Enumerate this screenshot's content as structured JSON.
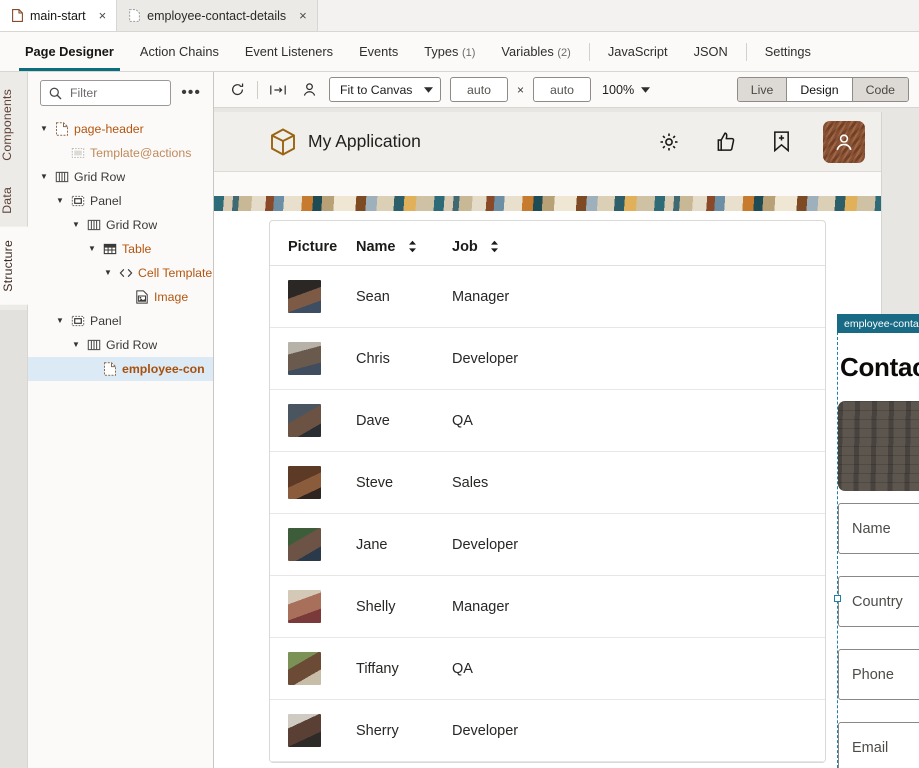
{
  "file_tabs": [
    {
      "label": "main-start",
      "icon": "document-icon",
      "active": true,
      "close": "×"
    },
    {
      "label": "employee-contact-details",
      "icon": "document-dashed-icon",
      "active": false,
      "close": "×"
    }
  ],
  "editor_tabs": [
    {
      "label": "Page Designer",
      "count": "",
      "active": true
    },
    {
      "label": "Action Chains",
      "count": "",
      "active": false
    },
    {
      "label": "Event Listeners",
      "count": "",
      "active": false
    },
    {
      "label": "Events",
      "count": "",
      "active": false
    },
    {
      "label": "Types",
      "count": "(1)",
      "active": false
    },
    {
      "label": "Variables",
      "count": "(2)",
      "active": false
    },
    {
      "label": "JavaScript",
      "count": "",
      "active": false
    },
    {
      "label": "JSON",
      "count": "",
      "active": false
    },
    {
      "label": "Settings",
      "count": "",
      "active": false
    }
  ],
  "rail": {
    "items": [
      {
        "label": "Components",
        "active": false
      },
      {
        "label": "Data",
        "active": false
      },
      {
        "label": "Structure",
        "active": true
      }
    ]
  },
  "structure": {
    "filter_placeholder": "Filter",
    "overflow_label": "•••",
    "tree": [
      {
        "label": "page-header",
        "depth": 0,
        "caret": "▼",
        "icon": "page-icon",
        "style": "orange",
        "selected": false
      },
      {
        "label": "Template@actions",
        "depth": 1,
        "caret": "",
        "icon": "template-icon",
        "style": "faded",
        "selected": false
      },
      {
        "label": "Grid Row",
        "depth": 0,
        "caret": "▼",
        "icon": "gridrow-icon",
        "style": "grey",
        "selected": false
      },
      {
        "label": "Panel",
        "depth": 1,
        "caret": "▼",
        "icon": "panel-icon",
        "style": "grey",
        "selected": false
      },
      {
        "label": "Grid Row",
        "depth": 2,
        "caret": "▼",
        "icon": "gridrow-icon",
        "style": "grey",
        "selected": false
      },
      {
        "label": "Table",
        "depth": 3,
        "caret": "▼",
        "icon": "table-icon",
        "style": "orange",
        "selected": false
      },
      {
        "label": "Cell Template",
        "depth": 4,
        "caret": "▼",
        "icon": "code-icon",
        "style": "orange",
        "selected": false
      },
      {
        "label": "Image",
        "depth": 5,
        "caret": "",
        "icon": "image-icon",
        "style": "orange",
        "selected": false
      },
      {
        "label": "Panel",
        "depth": 1,
        "caret": "▼",
        "icon": "panel-icon",
        "style": "grey",
        "selected": false
      },
      {
        "label": "Grid Row",
        "depth": 2,
        "caret": "▼",
        "icon": "gridrow-icon",
        "style": "grey",
        "selected": false
      },
      {
        "label": "employee-con",
        "depth": 3,
        "caret": "",
        "icon": "page-icon",
        "style": "selected",
        "selected": true
      }
    ]
  },
  "canvas_toolbar": {
    "refresh_icon": "refresh-icon",
    "resize_icon": "fit-width-icon",
    "user_icon": "user-icon",
    "fit_label": "Fit to Canvas",
    "width_value": "auto",
    "multiply": "×",
    "height_value": "auto",
    "zoom_value": "100%",
    "modes": [
      {
        "label": "Live",
        "active": false
      },
      {
        "label": "Design",
        "active": true
      },
      {
        "label": "Code",
        "active": false
      }
    ]
  },
  "app": {
    "logo_icon": "cube-logo-icon",
    "title": "My Application",
    "header_icons": [
      {
        "name": "gear-icon"
      },
      {
        "name": "thumbs-up-icon"
      },
      {
        "name": "bookmark-add-icon"
      }
    ],
    "avatar_icon": "user-avatar-icon"
  },
  "table": {
    "columns": [
      {
        "label": "Picture",
        "sortable": false
      },
      {
        "label": "Name",
        "sortable": true
      },
      {
        "label": "Job",
        "sortable": true
      }
    ],
    "rows": [
      {
        "picture": "employee-photo",
        "name": "Sean",
        "job": "Manager"
      },
      {
        "picture": "employee-photo",
        "name": "Chris",
        "job": "Developer"
      },
      {
        "picture": "employee-photo",
        "name": "Dave",
        "job": "QA"
      },
      {
        "picture": "employee-photo",
        "name": "Steve",
        "job": "Sales"
      },
      {
        "picture": "employee-photo",
        "name": "Jane",
        "job": "Developer"
      },
      {
        "picture": "employee-photo",
        "name": "Shelly",
        "job": "Manager"
      },
      {
        "picture": "employee-photo",
        "name": "Tiffany",
        "job": "QA"
      },
      {
        "picture": "employee-photo",
        "name": "Sherry",
        "job": "Developer"
      }
    ]
  },
  "fragment": {
    "tag_label": "employee-contact-details",
    "edit_icon": "pencil-icon",
    "heading": "Contact Info",
    "photo_placeholder": "photo-placeholder",
    "fields": [
      {
        "label": "Name"
      },
      {
        "label": "Country"
      },
      {
        "label": "Phone"
      },
      {
        "label": "Email"
      }
    ]
  },
  "colors": {
    "accent_teal": "#0a6e7d",
    "fragment_tag": "#186a85",
    "fragment_border": "#1f7fa8",
    "tree_orange": "#b4560f",
    "selection_blue": "#dbeaf4",
    "avatar_brown": "#8a4a28"
  }
}
